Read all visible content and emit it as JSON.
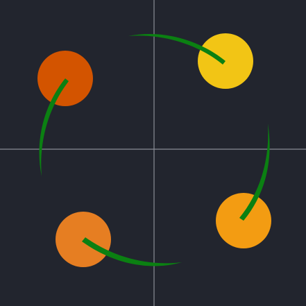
{
  "colors": {
    "background": "#22252e",
    "crosshair": "#8a8d96",
    "arc": "#0b8012",
    "dots": [
      "#f2c515",
      "#f39c12",
      "#e67e22",
      "#d35400"
    ]
  },
  "dots": [
    {
      "name": "yellow-dot",
      "color": "#f2c515"
    },
    {
      "name": "amber-dot",
      "color": "#f39c12"
    },
    {
      "name": "orange-dot",
      "color": "#e67e22"
    },
    {
      "name": "red-orange-dot",
      "color": "#d35400"
    }
  ]
}
